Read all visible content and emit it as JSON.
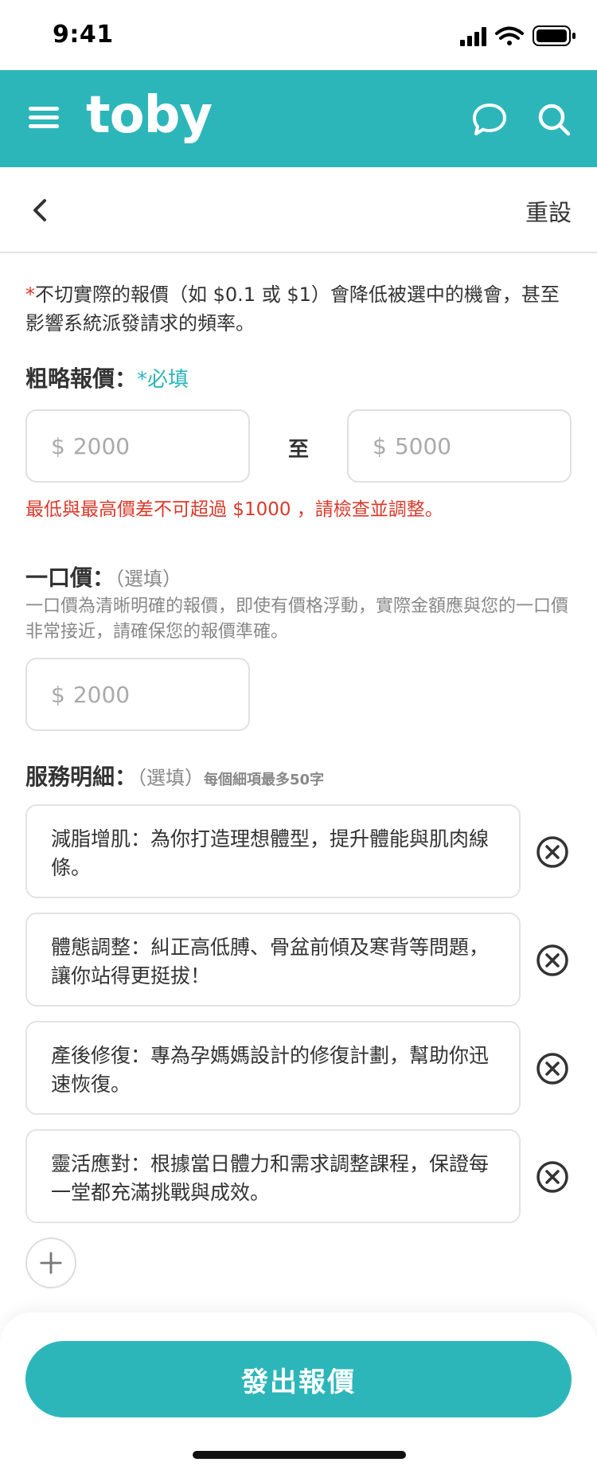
{
  "status_bar": {
    "time": "9:41"
  },
  "header": {
    "logo": "toby",
    "brand_color": "#2db6b9"
  },
  "sub_nav": {
    "reset_label": "重設"
  },
  "warning": {
    "star": "*",
    "text": "不切實際的報價（如 $0.1 或 $1）會降低被選中的機會，甚至影響系統派發請求的頻率。"
  },
  "rough_price": {
    "label": "粗略報價：",
    "required": "*必填",
    "currency": "$",
    "min_placeholder": "2000",
    "max_placeholder": "5000",
    "to_label": "至",
    "error": "最低與最高價差不可超過 $1000 ，請檢查並調整。"
  },
  "fixed_price": {
    "label": "一口價：",
    "optional": "（選填）",
    "hint": "一口價為清晰明確的報價，即使有價格浮動，實際金額應與您的一口價非常接近，請確保您的報價準確。",
    "currency": "$",
    "placeholder": "2000"
  },
  "service_details": {
    "label": "服務明細：",
    "optional": "（選填）",
    "limit": "每個細項最多50字",
    "items": [
      {
        "text": "減脂增肌：為你打造理想體型，提升體能與肌肉線條。"
      },
      {
        "text": "體態調整：糾正高低膊、骨盆前傾及寒背等問題，讓你站得更挺拔！"
      },
      {
        "text": "產後修復：專為孕媽媽設計的修復計劃，幫助你迅速恢復。"
      },
      {
        "text": "靈活應對：根據當日體力和需求調整課程，保證每一堂都充滿挑戰與成效。"
      }
    ]
  },
  "submit": {
    "label": "發出報價"
  }
}
